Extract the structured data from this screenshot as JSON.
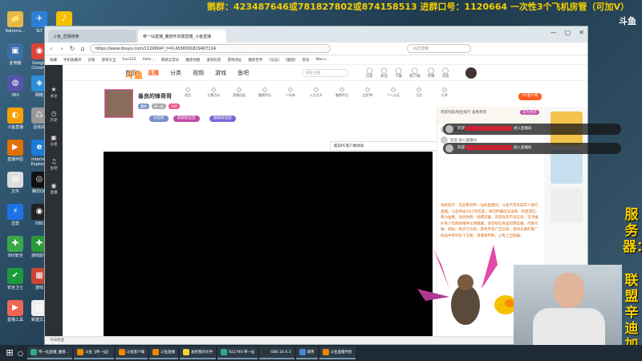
{
  "banner": {
    "text": "鹅群：423487646或781827802或874158513   进群口号：1120664   一次性3个飞机房管（可加V）"
  },
  "obs_logo": "斗鱼",
  "vertical_text": {
    "top": "服务器：",
    "bottom": "联盟辛迪加"
  },
  "desktop_icons": [
    {
      "label": "Adminis...",
      "color": "#e6b84a",
      "glyph": "📁"
    },
    {
      "label": "SLT",
      "color": "#2b7fd8",
      "glyph": "✈"
    },
    {
      "label": "QQ音乐",
      "color": "#f5c000",
      "glyph": "♪"
    },
    {
      "label": "此电脑",
      "color": "#3b6fa8",
      "glyph": "▣"
    },
    {
      "label": "Google Chrome",
      "color": "#db4437",
      "glyph": "◉"
    },
    {
      "label": "360",
      "color": "#55a",
      "glyph": "◍"
    },
    {
      "label": "网络",
      "color": "#2a8fd8",
      "glyph": "◈"
    },
    {
      "label": "斗鱼直播",
      "color": "#f5a000",
      "glyph": "◐"
    },
    {
      "label": "回收站",
      "color": "#999",
      "glyph": "♺"
    },
    {
      "label": "直播伴侣",
      "color": "#e07000",
      "glyph": "▶"
    },
    {
      "label": "Internet Explorer",
      "color": "#1a7cd6",
      "glyph": "e"
    },
    {
      "label": "文件",
      "color": "#ddd",
      "glyph": "▤"
    },
    {
      "label": "腾讯QQ",
      "color": "#111",
      "glyph": "◎"
    },
    {
      "label": "迅雷",
      "color": "#1a74e8",
      "glyph": "⚡"
    },
    {
      "label": "OBS",
      "color": "#222",
      "glyph": "◉"
    },
    {
      "label": "360安全",
      "color": "#3aa84a",
      "glyph": "✚"
    },
    {
      "label": "游戏助手",
      "color": "#2a9a3a",
      "glyph": "✚"
    },
    {
      "label": "安全卫士",
      "color": "#1a9a3a",
      "glyph": "✔"
    },
    {
      "label": "游戏",
      "color": "#c43",
      "glyph": "▦"
    },
    {
      "label": "直播工具",
      "color": "#e65",
      "glyph": "▶"
    },
    {
      "label": "新建文本",
      "color": "#eee",
      "glyph": "▤"
    }
  ],
  "browser": {
    "tabs": [
      {
        "label": "斗鱼_直播搜索"
      },
      {
        "label": "帝一仙直播_魔兽怀旧服直播_斗鱼直播"
      }
    ],
    "url": "https://www.douyu.com/1120664?_t=0.4536591819407114",
    "search_placeholder": "点此搜索",
    "bookmarks": [
      "收藏",
      "手机收藏夹",
      "谷歌",
      "游戏大全",
      "hao123",
      "Adds...",
      "网易云音乐",
      "魔兽地图",
      "发现标签",
      "游戏地址",
      "魔兽世界",
      "[论坛]",
      "[截图]",
      "资讯",
      "Warcr..."
    ]
  },
  "sidebar": [
    {
      "icon": "★",
      "label": "关注"
    },
    {
      "icon": "◷",
      "label": "历史"
    },
    {
      "icon": "▣",
      "label": "分类"
    },
    {
      "icon": "♫",
      "label": "鱼吧"
    },
    {
      "icon": "◉",
      "label": "直播"
    }
  ],
  "site": {
    "logo": "斗鱼",
    "nav": [
      "首页",
      "直播",
      "分类",
      "视频",
      "游戏",
      "鱼吧"
    ],
    "active_nav": "直播",
    "search_placeholder": "搜索主播",
    "header_icons": [
      "历史",
      "关注",
      "下载",
      "客户端",
      "开播",
      "消息"
    ]
  },
  "room": {
    "anchor_name": "善良的锋哥哥",
    "tags": [
      {
        "text": "魔兽",
        "color": "#7a8fcc"
      },
      {
        "text": "帝一仙",
        "color": "#aaa"
      },
      {
        "text": "306",
        "color": "#e58"
      }
    ],
    "toolbar": [
      "首页",
      "主播活动",
      "直播回放",
      "魔兽怀旧",
      "少年来",
      "火力全开",
      "魔兽怀旧",
      "全民PK",
      "个人认证",
      "日志",
      "分享"
    ],
    "pills": [
      {
        "text": "分区榜",
        "color": "#7b8fcc"
      },
      {
        "text": "超级粉丝团",
        "color": "#c24aa8"
      },
      {
        "text": "超级粉丝团",
        "color": "#7a6bd6"
      }
    ],
    "pc_button": "PC客户端",
    "popup_text": "超前PC客户端体验",
    "popup_close": "×"
  },
  "gifts": [
    {
      "label": "超级火箭",
      "color": "#e8a23a"
    },
    {
      "label": "飞机",
      "color": "#7a6bd6"
    },
    {
      "label": "",
      "color": "#e0d0d0"
    },
    {
      "label": "超级乐",
      "color": "#4a8fd8"
    },
    {
      "label": "火箭",
      "color": "#3aa84a"
    },
    {
      "label": "飞船",
      "color": "#e05a3a"
    },
    {
      "label": "礼物",
      "color": "#c24aa8"
    }
  ],
  "chat": {
    "rank_head": "贵宾列表/粉丝排行 查看贵宾",
    "rank_button": "成为贵宾",
    "rank_rows": [
      "欢迎 来到 本直播间",
      "欢迎 进入直播间"
    ],
    "notice": "系统提示：欢迎来到帝一仙的直播间，斗鱼严禁未成年人进行直播，斗鱼将会24小时巡查，请勿传播违法违规、封建迷信、暴力血腥、低俗色情、招嫖诈骗、违禁品等不良信息，坚决维护青少年群体精神文明健康。请勿轻信各类招聘征婚、代练代抽、刷钻、购买礼包码、游戏币等广告信息，且如主播在推广商品中诱导私下交易，请谨慎判断，以免上当受骗。"
  },
  "overlay_chat": [
    {
      "prefix": "欢迎",
      "name": "",
      "suffix": "进入直播间"
    },
    {
      "prefix": "欢迎",
      "name": "",
      "suffix": "进入直播间"
    }
  ],
  "ads": [
    {
      "color": "#f2c24a"
    },
    {
      "color": "#c7e0f0"
    },
    {
      "color": "#eee"
    }
  ],
  "statusbar": "今日优选",
  "taskbar": [
    {
      "label": "帝一仙直播_魔兽...",
      "color": "#3a8"
    },
    {
      "label": "斗鱼【帝一仙】",
      "color": "#e80"
    },
    {
      "label": "斗鱼客户端",
      "color": "#e80"
    },
    {
      "label": "斗鱼直播",
      "color": "#e80"
    },
    {
      "label": "发给我的文件",
      "color": "#fc3"
    },
    {
      "label": "922790-帝一仙",
      "color": "#3a8"
    },
    {
      "label": "OBS 24.0.3",
      "color": "#333"
    },
    {
      "label": "调用",
      "color": "#48c"
    },
    {
      "label": "斗鱼直播伴侣",
      "color": "#e80"
    }
  ]
}
